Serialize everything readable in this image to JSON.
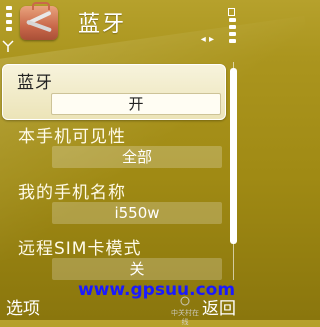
{
  "header": {
    "title": "蓝牙",
    "app_icon": "toolbox-icon",
    "signal_icon": "signal-strength-icon",
    "battery_icon": "battery-icon"
  },
  "settings": [
    {
      "label": "蓝牙",
      "value": "开",
      "selected": true
    },
    {
      "label": "本手机可见性",
      "value": "全部"
    },
    {
      "label": "我的手机名称",
      "value": "i550w"
    },
    {
      "label": "远程SIM卡模式",
      "value": "关"
    }
  ],
  "softkeys": {
    "left": "选项",
    "right": "返回"
  },
  "watermark": {
    "text": "www.gpsuu.com",
    "logo_text": "中关村在线"
  },
  "colors": {
    "background": "#a8921b",
    "selection": "#f3edcc",
    "watermark": "#1a1aff"
  }
}
